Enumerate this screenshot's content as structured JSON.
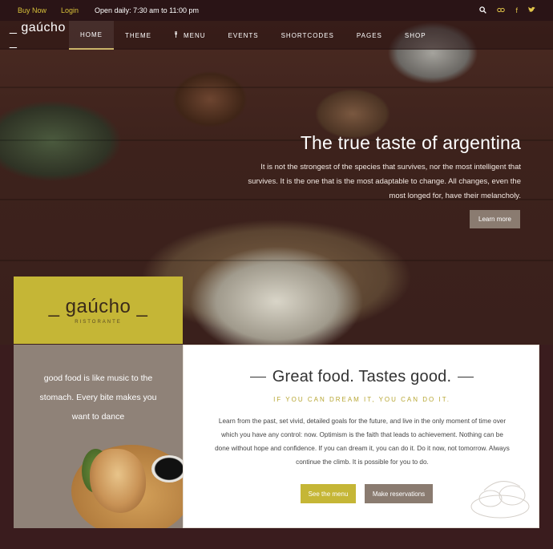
{
  "topbar": {
    "buy_now": "Buy Now",
    "login": "Login",
    "hours": "Open daily: 7:30 am to 11:00 pm",
    "icons": [
      "search-icon",
      "tripadvisor-icon",
      "facebook-icon",
      "twitter-icon"
    ]
  },
  "nav": {
    "logo": "_ gaúcho _",
    "items": [
      {
        "label": "HOME"
      },
      {
        "label": "THEME"
      },
      {
        "label": "MENU"
      },
      {
        "label": "EVENTS"
      },
      {
        "label": "SHORTCODES"
      },
      {
        "label": "PAGES"
      },
      {
        "label": "SHOP"
      }
    ]
  },
  "hero": {
    "title": "The true taste of argentina",
    "text": "It is not the strongest of the species that survives, nor the most intelligent that survives. It is the one that is the most adaptable to change. All changes, even the most longed for, have their melancholy.",
    "button": "Learn more"
  },
  "brand": {
    "name": "_ gaúcho _",
    "sub": "RISTORANTE"
  },
  "left_panel": {
    "quote": "good food is like music to the stomach. Every bite makes you want to dance"
  },
  "main_panel": {
    "heading": "Great food. Tastes good.",
    "tagline": "IF YOU CAN DREAM IT, YOU CAN DO IT.",
    "body": "Learn from the past, set vivid, detailed goals for the future, and live in the only moment of time over which you have any control: now. Optimism is the faith that leads to achievement. Nothing can be done without hope and confidence. If you can dream it, you can do it. Do it now, not tomorrow. Always continue the climb. It is possible for you to do.",
    "btn_menu": "See the menu",
    "btn_reservations": "Make reservations"
  },
  "colors": {
    "accent": "#c5b636",
    "topbar": "#2a1416",
    "muted_button": "#8a7b70"
  }
}
